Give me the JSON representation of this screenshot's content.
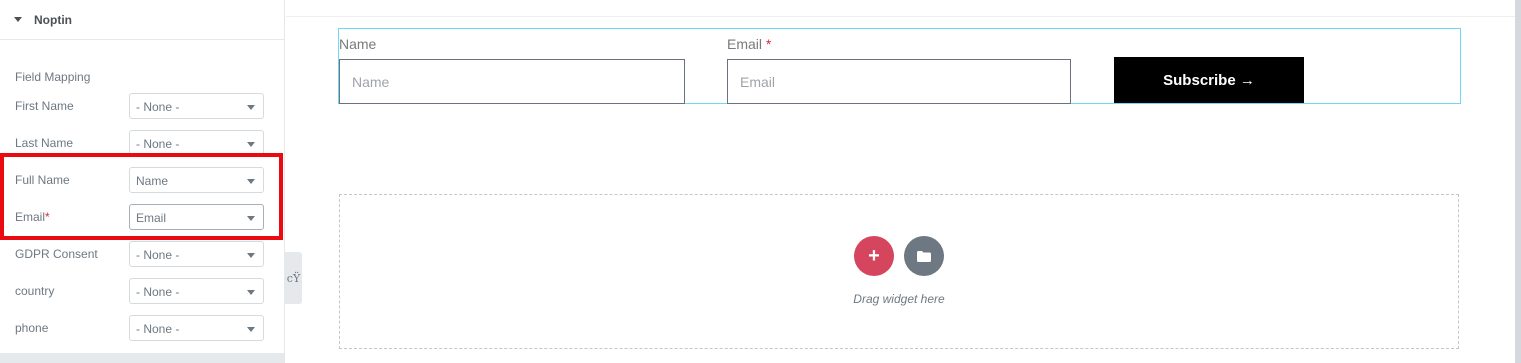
{
  "panel": {
    "section_title": "Noptin",
    "field_mapping_label": "Field Mapping",
    "rows": [
      {
        "label": "First Name",
        "required": false,
        "value": "- None -"
      },
      {
        "label": "Last Name",
        "required": false,
        "value": "- None -"
      },
      {
        "label": "Full Name",
        "required": false,
        "value": "Name"
      },
      {
        "label": "Email",
        "required": true,
        "value": "Email"
      },
      {
        "label": "GDPR Consent",
        "required": false,
        "value": "- None -"
      },
      {
        "label": "country",
        "required": false,
        "value": "- None -"
      },
      {
        "label": "phone",
        "required": false,
        "value": "- None -"
      }
    ],
    "required_mark": "*",
    "collapse_glyph": "cŸ"
  },
  "form": {
    "name_label": "Name",
    "name_placeholder": "Name",
    "email_label": "Email",
    "email_required_mark": "*",
    "email_placeholder": "Email",
    "subscribe_label": "Subscribe →"
  },
  "drop_zone": {
    "add_symbol": "+",
    "hint": "Drag widget here"
  },
  "colors": {
    "highlight": "#ea0b10",
    "subscribe_bg": "#000000",
    "add_button": "#d5455e",
    "folder_button": "#6d7882",
    "form_border": "#71d7f7"
  },
  "icons": {
    "section_caret": "caret-down-icon",
    "select_arrow": "chevron-down-icon",
    "add": "plus-icon",
    "library": "folder-icon"
  }
}
